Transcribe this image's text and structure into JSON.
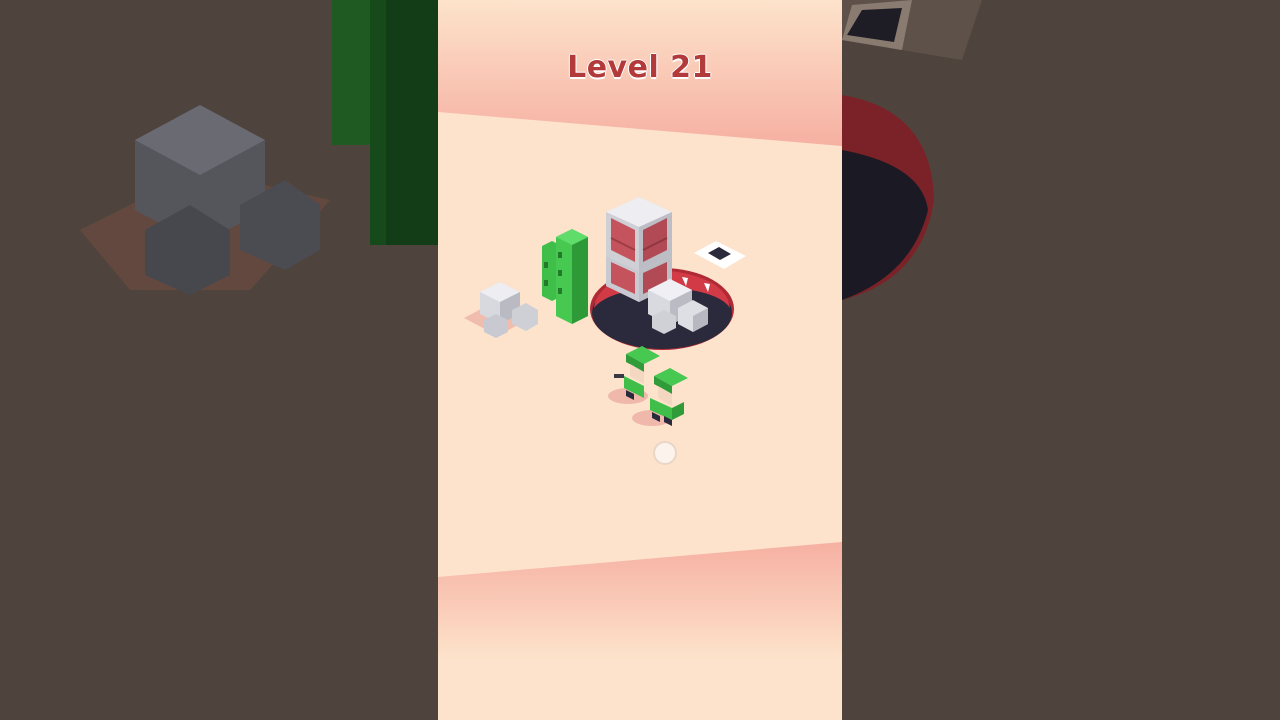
{
  "hud": {
    "level_label": "Level 21"
  },
  "scene": {
    "objects": [
      "hole",
      "rock-cluster",
      "cactus",
      "brick-crate-stack",
      "small-rock-cluster",
      "floor-tile",
      "soldier",
      "soldier"
    ],
    "touch_indicator": true
  },
  "colors": {
    "background_blur": "#4f443d",
    "ground": "#fde3cb",
    "edge_gradient": "#f6b2a4",
    "hole_rim": "#c62e3c",
    "hole_inside": "#2b2a3c",
    "cactus": "#3fbf4a",
    "crate": "#c8545f",
    "rock": "#d7d8de",
    "title_text": "#b23a3a"
  }
}
